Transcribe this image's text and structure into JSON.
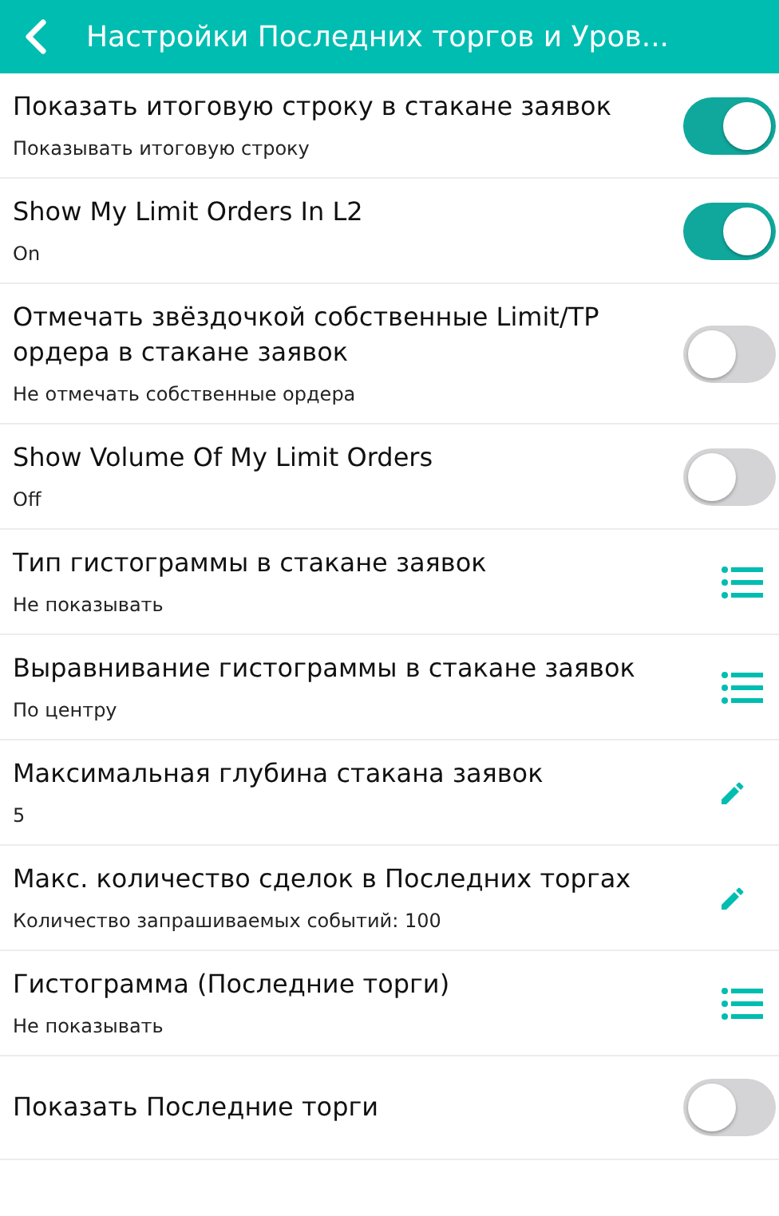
{
  "header": {
    "title": "Настройки Последних торгов и Уров..."
  },
  "settings": [
    {
      "kind": "toggle",
      "title": "Показать итоговую строку в стакане заявок",
      "subtitle": "Показывать итоговую строку",
      "on": true
    },
    {
      "kind": "toggle",
      "title": "Show My Limit Orders In L2",
      "subtitle": "On",
      "on": true
    },
    {
      "kind": "toggle",
      "title": "Отмечать звёздочкой собственные Limit/TP ордера в стакане заявок",
      "subtitle": "Не отмечать собственные ордера",
      "on": false
    },
    {
      "kind": "toggle",
      "title": "Show Volume Of My Limit Orders",
      "subtitle": "Off",
      "on": false
    },
    {
      "kind": "list",
      "title": "Тип гистограммы в стакане заявок",
      "subtitle": "Не показывать"
    },
    {
      "kind": "list",
      "title": "Выравнивание гистограммы в стакане заявок",
      "subtitle": "По центру"
    },
    {
      "kind": "edit",
      "title": "Максимальная глубина стакана заявок",
      "subtitle": "5"
    },
    {
      "kind": "edit",
      "title": "Макс. количество сделок в Последних торгах",
      "subtitle": "Количество запрашиваемых событий: 100"
    },
    {
      "kind": "list",
      "title": "Гистограмма (Последние торги)",
      "subtitle": "Не показывать"
    },
    {
      "kind": "toggle",
      "title": "Показать Последние торги",
      "on": false
    }
  ]
}
